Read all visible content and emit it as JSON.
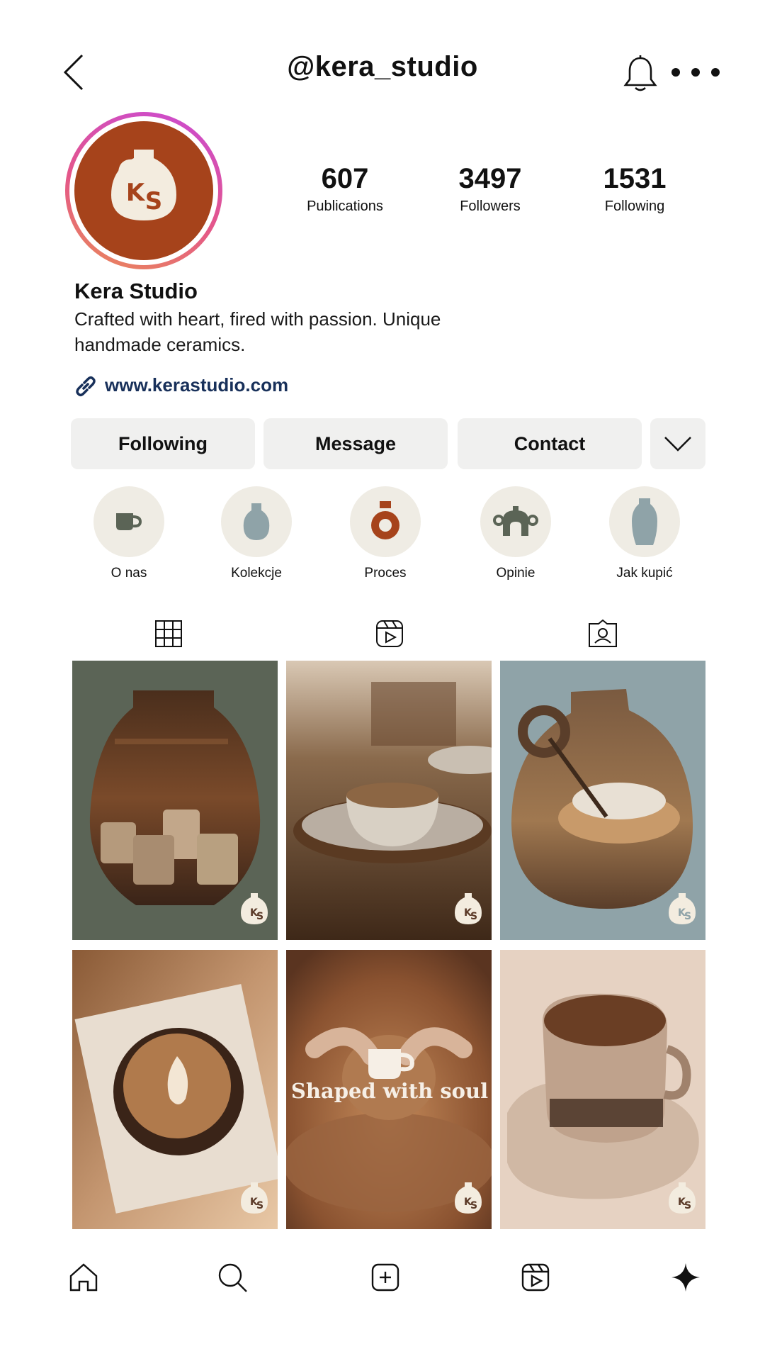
{
  "header": {
    "username": "@kera_studio"
  },
  "profile": {
    "avatar_monogram": "KS",
    "name": "Kera Studio",
    "bio": "Crafted with heart, fired with passion. Unique handmade ceramics.",
    "website": "www.kerastudio.com"
  },
  "stats": [
    {
      "value": "607",
      "label": "Publications"
    },
    {
      "value": "3497",
      "label": "Followers"
    },
    {
      "value": "1531",
      "label": "Following"
    }
  ],
  "buttons": {
    "following": "Following",
    "message": "Message",
    "contact": "Contact"
  },
  "highlights": [
    {
      "label": "O nas",
      "icon": "mug-icon"
    },
    {
      "label": "Kolekcje",
      "icon": "vase-icon"
    },
    {
      "label": "Proces",
      "icon": "ring-vase-icon"
    },
    {
      "label": "Opinie",
      "icon": "teapot-icon"
    },
    {
      "label": "Jak kupić",
      "icon": "vase-icon"
    }
  ],
  "tabs": [
    "grid-icon",
    "reels-icon",
    "tagged-icon"
  ],
  "posts": [
    {
      "description": "cups in vase-shaped frame",
      "overlay_text": ""
    },
    {
      "description": "ceramic bowl on tray",
      "overlay_text": ""
    },
    {
      "description": "jug-shaped frame with glazing",
      "overlay_text": ""
    },
    {
      "description": "latte in ceramic cup",
      "overlay_text": ""
    },
    {
      "description": "pottery wheel",
      "overlay_text": "Shaped with soul"
    },
    {
      "description": "coffee cup on saucer",
      "overlay_text": ""
    }
  ],
  "colors": {
    "brand": "#a6431b",
    "sage": "#5b6456",
    "slate_blue": "#8fa3a8",
    "cream": "#efece4",
    "link": "#18305a"
  },
  "bottom_nav": [
    "home-icon",
    "search-icon",
    "create-icon",
    "reels-icon",
    "ai-sparkle-icon"
  ]
}
